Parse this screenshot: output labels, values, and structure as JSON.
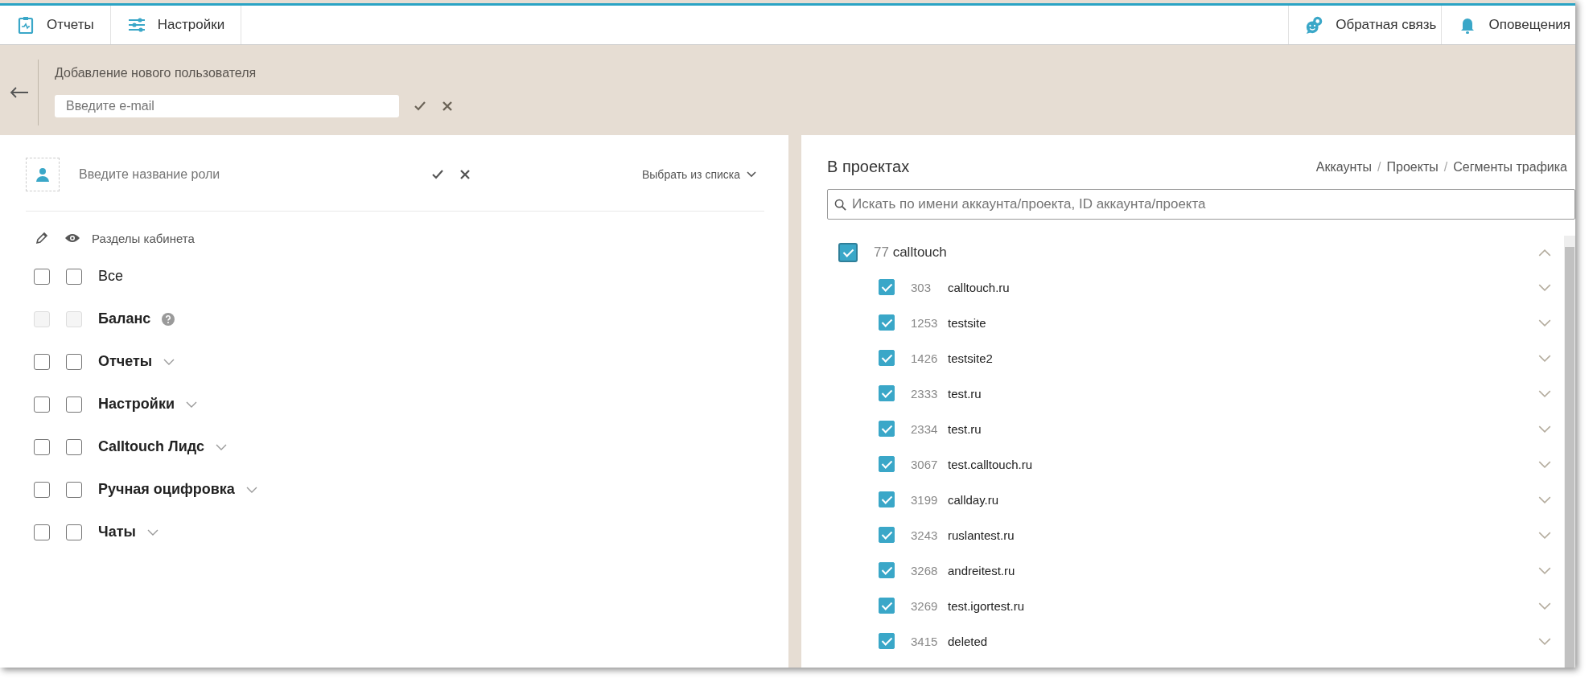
{
  "nav": {
    "left": [
      {
        "label": "Отчеты"
      },
      {
        "label": "Настройки"
      }
    ],
    "right": [
      {
        "label": "Обратная связь"
      },
      {
        "label": "Оповещения"
      }
    ]
  },
  "header": {
    "title": "Добавление нового пользователя",
    "email": {
      "placeholder": "Введите e-mail"
    }
  },
  "role": {
    "placeholder": "Введите название роли",
    "select_label": "Выбрать из списка"
  },
  "sections": {
    "title": "Разделы кабинета",
    "items": [
      {
        "label": "Все",
        "kind": "all",
        "edit": {
          "checked": false,
          "disabled": false
        },
        "view": {
          "checked": false,
          "disabled": false
        }
      },
      {
        "label": "Баланс",
        "kind": "info",
        "edit": {
          "checked": false,
          "disabled": true
        },
        "view": {
          "checked": false,
          "disabled": true
        }
      },
      {
        "label": "Отчеты",
        "kind": "group",
        "edit": {
          "checked": false,
          "disabled": false
        },
        "view": {
          "checked": false,
          "disabled": false
        }
      },
      {
        "label": "Настройки",
        "kind": "group",
        "edit": {
          "checked": false,
          "disabled": false
        },
        "view": {
          "checked": false,
          "disabled": false
        }
      },
      {
        "label": "Calltouch Лидс",
        "kind": "group",
        "edit": {
          "checked": false,
          "disabled": false
        },
        "view": {
          "checked": false,
          "disabled": false
        }
      },
      {
        "label": "Ручная оцифровка",
        "kind": "group",
        "edit": {
          "checked": false,
          "disabled": false
        },
        "view": {
          "checked": false,
          "disabled": false
        }
      },
      {
        "label": "Чаты",
        "kind": "group",
        "edit": {
          "checked": false,
          "disabled": false
        },
        "view": {
          "checked": false,
          "disabled": false
        }
      }
    ]
  },
  "projects": {
    "title": "В проектах",
    "breadcrumbs": [
      {
        "kind": "link",
        "text": "Аккаунты"
      },
      {
        "kind": "separator",
        "text": "/"
      },
      {
        "kind": "link",
        "text": "Проекты"
      },
      {
        "kind": "separator",
        "text": "/"
      },
      {
        "kind": "link",
        "text": "Сегменты трафика"
      }
    ],
    "search": {
      "placeholder": "Искать по имени аккаунта/проекта, ID аккаунта/проекта"
    },
    "account": {
      "id": "77",
      "name": "calltouch",
      "checked": true,
      "expanded": true,
      "children": [
        {
          "id": "303",
          "name": "calltouch.ru",
          "checked": true,
          "expanded": false
        },
        {
          "id": "1253",
          "name": "testsite",
          "checked": true,
          "expanded": false
        },
        {
          "id": "1426",
          "name": "testsite2",
          "checked": true,
          "expanded": false
        },
        {
          "id": "2333",
          "name": "test.ru",
          "checked": true,
          "expanded": false
        },
        {
          "id": "2334",
          "name": "test.ru",
          "checked": true,
          "expanded": false
        },
        {
          "id": "3067",
          "name": "test.calltouch.ru",
          "checked": true,
          "expanded": false
        },
        {
          "id": "3199",
          "name": "callday.ru",
          "checked": true,
          "expanded": false
        },
        {
          "id": "3243",
          "name": "ruslantest.ru",
          "checked": true,
          "expanded": false
        },
        {
          "id": "3268",
          "name": "andreitest.ru",
          "checked": true,
          "expanded": false
        },
        {
          "id": "3269",
          "name": "test.igortest.ru",
          "checked": true,
          "expanded": false
        },
        {
          "id": "3415",
          "name": "deleted",
          "checked": true,
          "expanded": false
        }
      ]
    }
  }
}
